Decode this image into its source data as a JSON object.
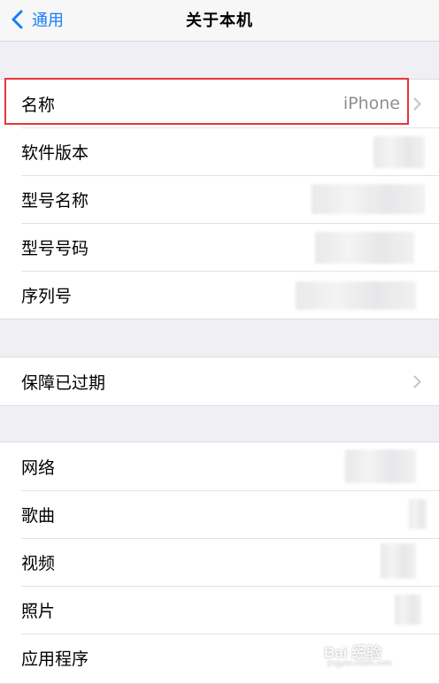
{
  "navbar": {
    "back_label": "通用",
    "title": "关于本机"
  },
  "group1": [
    {
      "label": "名称",
      "value": "iPhone",
      "has_chevron": true
    },
    {
      "label": "软件版本",
      "value": ""
    },
    {
      "label": "型号名称",
      "value": ""
    },
    {
      "label": "型号号码",
      "value": ""
    },
    {
      "label": "序列号",
      "value": ""
    }
  ],
  "group2": [
    {
      "label": "保障已过期",
      "has_chevron": true
    }
  ],
  "group3": [
    {
      "label": "网络",
      "value": ""
    },
    {
      "label": "歌曲",
      "value": ""
    },
    {
      "label": "视频",
      "value": ""
    },
    {
      "label": "照片",
      "value": ""
    },
    {
      "label": "应用程序",
      "value": ""
    }
  ],
  "colors": {
    "accent": "#1a7cf5",
    "highlight": "#e8353a",
    "background": "#efeff4"
  },
  "icons": {
    "back": "chevron-left-icon",
    "disclosure": "chevron-right-icon"
  },
  "watermark": {
    "brand": "Bai 经验",
    "url": "jingyan.baidu.com"
  }
}
